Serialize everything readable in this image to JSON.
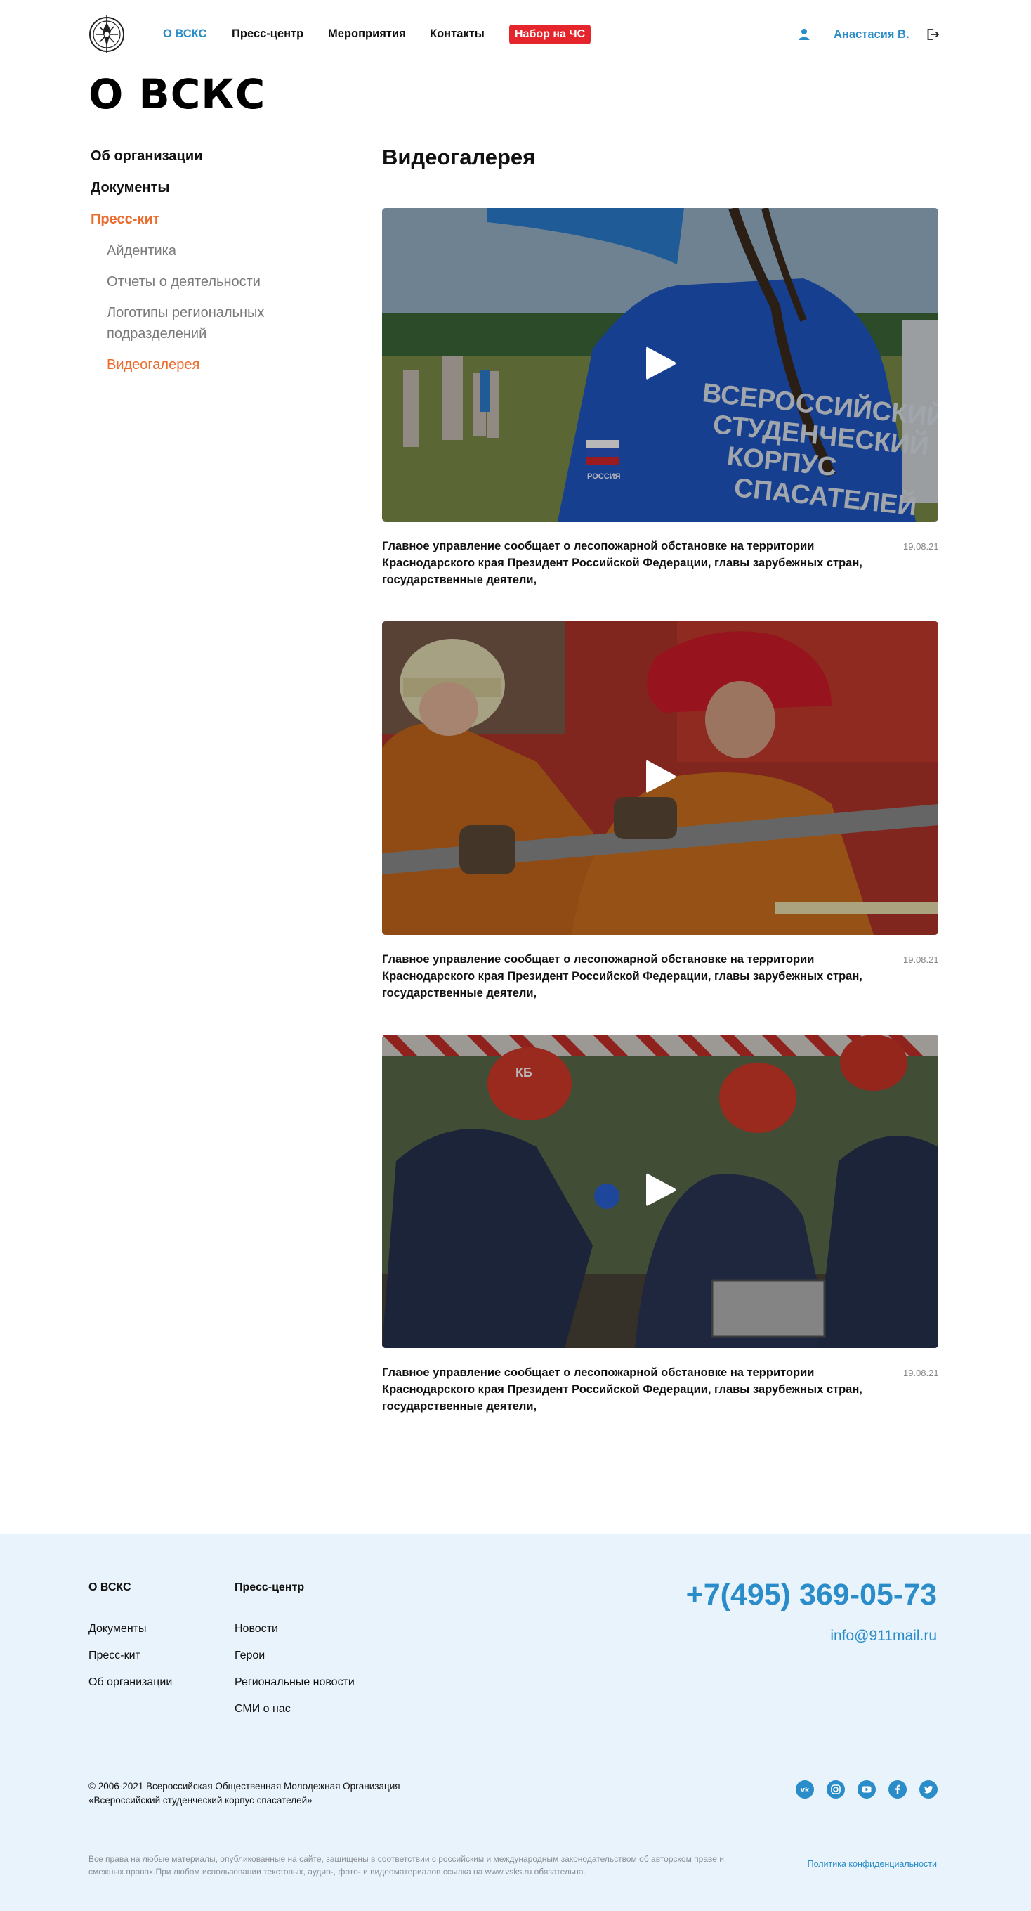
{
  "header": {
    "nav": [
      {
        "label": "О ВСКС",
        "active": true
      },
      {
        "label": "Пресс-центр",
        "active": false
      },
      {
        "label": "Мероприятия",
        "active": false
      },
      {
        "label": "Контакты",
        "active": false
      }
    ],
    "badge": "Набор на ЧС",
    "user_name": "Анастасия В.",
    "icons": [
      "emblem-logo",
      "user-icon",
      "logout-icon"
    ]
  },
  "page_title": "О ВСКС",
  "sidebar": {
    "items": [
      {
        "label": "Об организации",
        "active": false
      },
      {
        "label": "Документы",
        "active": false
      },
      {
        "label": "Пресс-кит",
        "active": true
      }
    ],
    "subitems": [
      {
        "label": "Айдентика",
        "active": false
      },
      {
        "label": "Отчеты о деятельности",
        "active": false
      },
      {
        "label": "Логотипы региональных подразделений",
        "active": false
      },
      {
        "label": "Видеогалерея",
        "active": true
      }
    ]
  },
  "main": {
    "title": "Видеогалерея",
    "videos": [
      {
        "caption": "Главное управление сообщает о лесопожарной обстановке на территории Краснодарского края Президент Российской Федерации, главы зарубежных стран, государственные деятели,",
        "date": "19.08.21",
        "thumb_printed_text": [
          "ВСЕРОССИЙСКИЙ",
          "СТУДЕНЧЕСКИЙ",
          "КОРПУС",
          "СПАСАТЕЛЕЙ",
          "РОССИЯ"
        ]
      },
      {
        "caption": "Главное управление сообщает о лесопожарной обстановке на территории Краснодарского края Президент Российской Федерации, главы зарубежных стран, государственные деятели,",
        "date": "19.08.21"
      },
      {
        "caption": "Главное управление сообщает о лесопожарной обстановке на территории Краснодарского края Президент Российской Федерации, главы зарубежных стран, государственные деятели,",
        "date": "19.08.21",
        "thumb_printed_text": [
          "КБ"
        ]
      }
    ]
  },
  "footer": {
    "col1": {
      "head": "О ВСКС",
      "links": [
        "Документы",
        "Пресс-кит",
        "Об организации"
      ]
    },
    "col2": {
      "head": "Пресс-центр",
      "links": [
        "Новости",
        "Герои",
        "Региональные новости",
        "СМИ о нас"
      ]
    },
    "phone": "+7(495) 369-05-73",
    "email": "info@911mail.ru",
    "copyright_line1": "© 2006-2021 Всероссийская Общественная Молодежная Организация",
    "copyright_line2": "«Всероссийский студенческий корпус спасателей»",
    "social": [
      "vk-icon",
      "instagram-icon",
      "youtube-icon",
      "facebook-icon",
      "twitter-icon"
    ],
    "legal": "Все права на любые материалы, опубликованные на сайте, защищены в соответствии с российским и международным законодательством об авторском праве и смежных правах.При любом использовании текстовых, аудио-, фото- и видеоматериалов ссылка на www.vsks.ru обязательна.",
    "privacy": "Политика конфиденциальности",
    "colors": {
      "accent": "#2a8cc8",
      "active": "#ec6b2d",
      "badge": "#e4252b",
      "footer_bg": "#e9f3fb"
    }
  }
}
